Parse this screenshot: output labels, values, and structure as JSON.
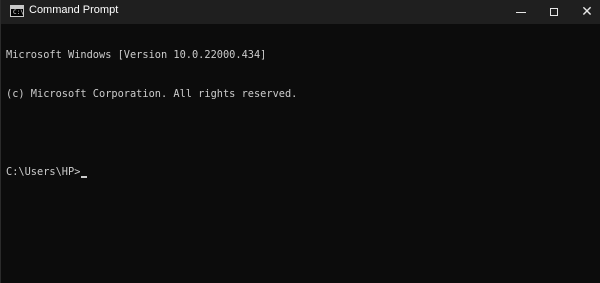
{
  "window": {
    "title": "Command Prompt",
    "icon": "cmd-icon",
    "icon_prompt": "C:\\",
    "controls": {
      "minimize_icon": "minimize-icon",
      "maximize_icon": "maximize-icon",
      "close_icon": "close-icon",
      "close_glyph": "✕"
    }
  },
  "console": {
    "lines": [
      "Microsoft Windows [Version 10.0.22000.434]",
      "(c) Microsoft Corporation. All rights reserved.",
      ""
    ],
    "prompt": "C:\\Users\\HP>"
  },
  "colors": {
    "background": "#0c0c0c",
    "titlebar": "#1f1f1f",
    "text": "#cccccc"
  }
}
